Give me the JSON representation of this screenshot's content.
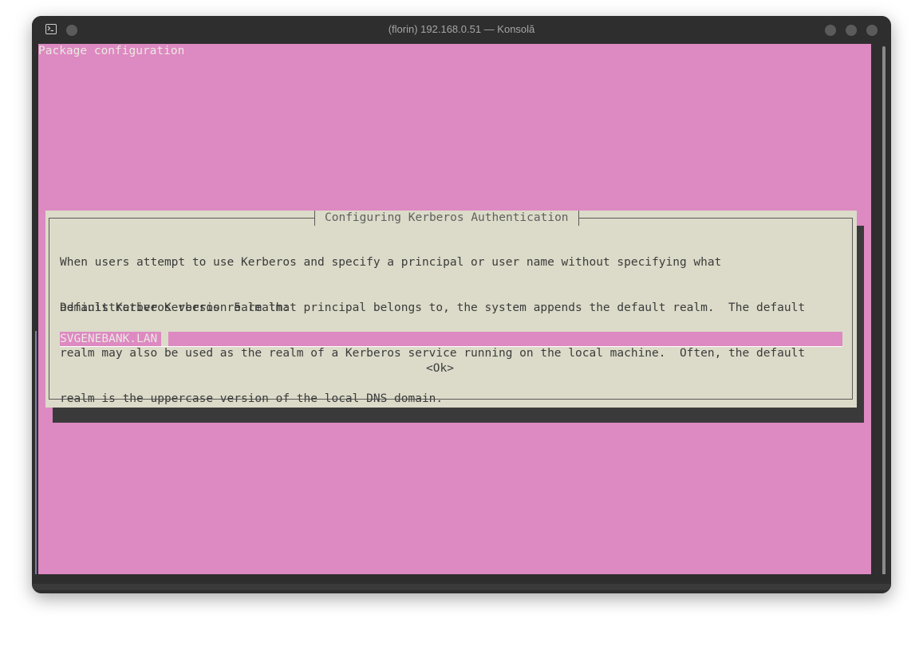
{
  "window": {
    "title": "(florin) 192.168.0.51 — Konsolă"
  },
  "terminal": {
    "header": "Package configuration",
    "dialog": {
      "title": "Configuring Kerberos Authentication",
      "description_lines": [
        "When users attempt to use Kerberos and specify a principal or user name without specifying what",
        "administrative Kerberos realm that principal belongs to, the system appends the default realm.  The default",
        "realm may also be used as the realm of a Kerberos service running on the local machine.  Often, the default",
        "realm is the uppercase version of the local DNS domain."
      ],
      "prompt": "Default Kerberos version 5 realm:",
      "input_value": "SVGENEBANK.LAN",
      "ok_button": "<Ok>"
    }
  },
  "colors": {
    "terminal_background": "#dd89c2",
    "dialog_background": "#dcdbc9",
    "window_chrome": "#2e2e2e"
  }
}
